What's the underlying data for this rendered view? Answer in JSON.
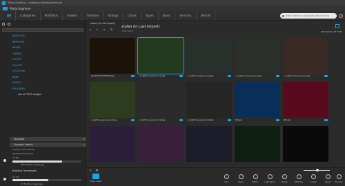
{
  "window": {
    "title": "Photo Supreme - database-photosupreme.sdi"
  },
  "app": {
    "name": "Photo Supreme"
  },
  "tabs": [
    "All",
    "Categories",
    "Portfolios",
    "Folders",
    "Timeline",
    "Ratings",
    "Colors",
    "Types",
    "Rules",
    "Versions",
    "Details"
  ],
  "search": {
    "placeholder": "Enter search or advanced search string"
  },
  "sidebar": {
    "categories": [
      "ANCESTORS",
      "BEMPORTA",
      "BRAND",
      "CAMERA",
      "EXPORT",
      "GALLERY",
      "LOCATIONS",
      "NAME",
      "PEOPLE",
      "PROVIDERS"
    ],
    "see_all": "see all 7923 images",
    "sections": {
      "favorites": "Favorites",
      "dynamic_search": "Dynamic Search"
    },
    "activity": "Activity (2 processes)",
    "sync": {
      "title": "Synchronize Service",
      "pct": "72.0%",
      "pct_value": 0.72,
      "detail": "467 Feather Organ.jpg"
    },
    "thumbs": {
      "title": "Building Thumbnails",
      "pct": "52.1%",
      "pct_value": 0.521,
      "detail": "87 Feather Organ.jpg"
    }
  },
  "main": {
    "crumb": "states (In Last Import)",
    "heading": "states (In Last Import)",
    "subheading": "7923 Items",
    "date": "Wednesday 02 2023"
  },
  "thumbnails": [
    {
      "caption": "_DSc40149475793796.jpg",
      "color": "#1c1208"
    },
    {
      "caption": "~lucigthm-essenza-scv12.jpg",
      "color": "#243a1f",
      "selected": true
    },
    {
      "caption": "~lucigthm-essenza-scv12.jpg",
      "color": "#27302a"
    },
    {
      "caption": "~lucigthm-essenza-scv12.jpg",
      "color": "#2a2f2a"
    },
    {
      "caption": "~lucigthm-essenza-scv12.jpg",
      "color": "#3a2a26"
    },
    {
      "caption": "~lucigthm-essenza-scv12.jpg",
      "color": "#2d3b1f"
    },
    {
      "caption": "~lucigthm-essenza-scv12.jpg",
      "color": "#2b2b2b"
    },
    {
      "caption": "~lucigthm-essenza-scv12.jpg",
      "color": "#252525"
    },
    {
      "caption": "004.jpg",
      "color": "#0a2e5a"
    },
    {
      "caption": "003.jpg",
      "color": "#5a0a1e"
    },
    {
      "caption": "",
      "color": "#2a1e3a"
    },
    {
      "caption": "",
      "color": "#3a1f3a"
    },
    {
      "caption": "",
      "color": "#1c1c2a"
    },
    {
      "caption": "",
      "color": "#101f14"
    },
    {
      "caption": "",
      "color": "#0a0a0a"
    }
  ],
  "bottom": {
    "image_viewer": "Image Viewer",
    "tools": [
      "Info",
      "Share",
      "Batch",
      "Light Table",
      "Delete",
      "GEO Tag",
      "Labels",
      "Adjust",
      "Preview"
    ]
  }
}
